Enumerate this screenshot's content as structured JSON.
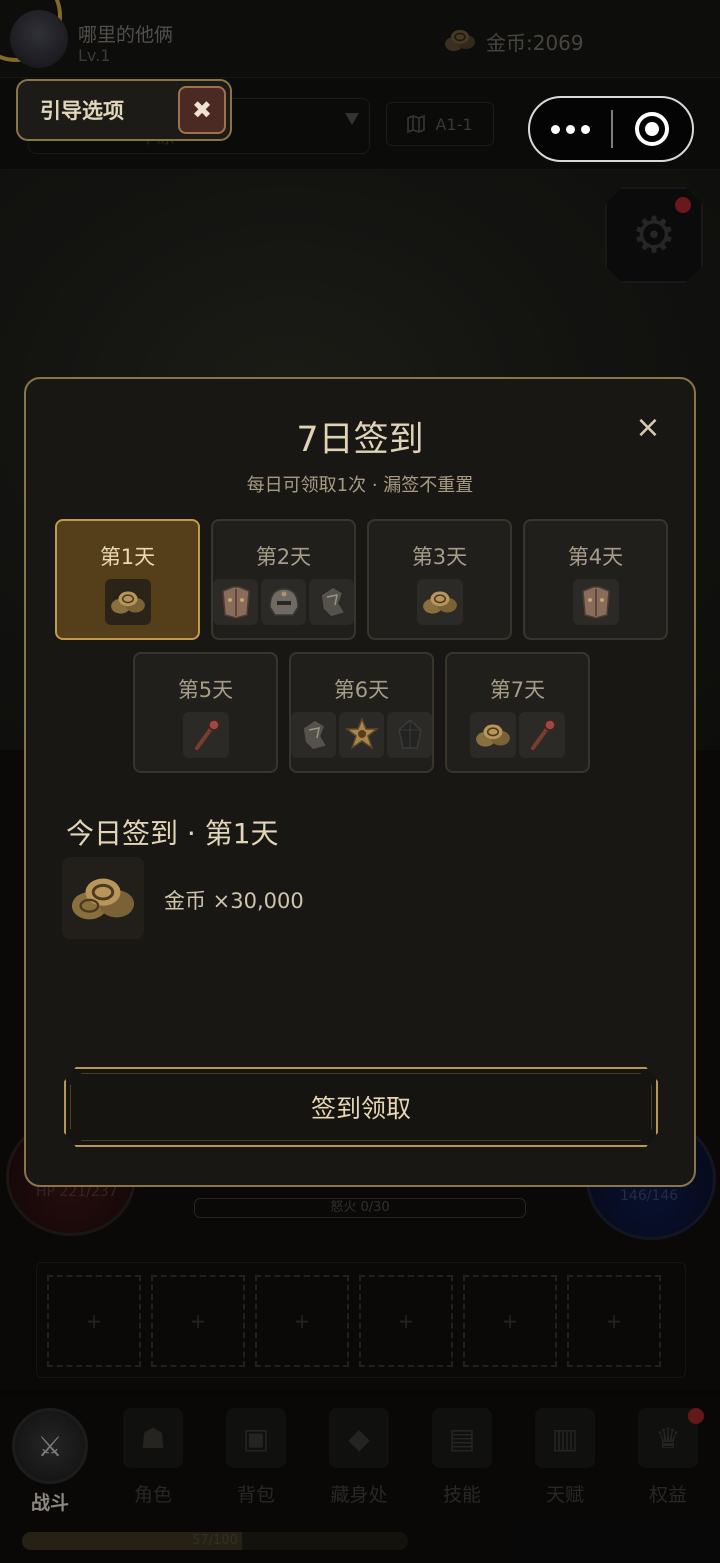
{
  "header": {
    "player_name": "哪里的他俩",
    "player_level": "Lv.1",
    "gold_label": "金币:2069"
  },
  "subbar": {
    "select_text": "平原",
    "map_label": "A1-1"
  },
  "guide": {
    "label": "引导选项",
    "close_glyph": "✖"
  },
  "rage": {
    "label": "怒火 0/30"
  },
  "hp": {
    "label": "HP 221/237"
  },
  "mp": {
    "label": "146/146"
  },
  "slots": [
    "+",
    "+",
    "+",
    "+",
    "+",
    "+"
  ],
  "nav": {
    "items": [
      {
        "label": "战斗",
        "icon": "crossed-swords-icon",
        "glyph": "⚔"
      },
      {
        "label": "角色",
        "icon": "character-helmet-icon",
        "glyph": "☗"
      },
      {
        "label": "背包",
        "icon": "backpack-icon",
        "glyph": "▣"
      },
      {
        "label": "藏身处",
        "icon": "hideout-icon",
        "glyph": "◆"
      },
      {
        "label": "技能",
        "icon": "skill-book-icon",
        "glyph": "▤"
      },
      {
        "label": "天赋",
        "icon": "talent-cards-icon",
        "glyph": "▥"
      },
      {
        "label": "权益",
        "icon": "crown-icon",
        "glyph": "♛"
      }
    ],
    "active_index": 0
  },
  "exp": {
    "label": "57/100",
    "progress": 0.57
  },
  "modal": {
    "title": "7日签到",
    "close_glyph": "×",
    "subtitle": "每日可领取1次 · 漏签不重置",
    "days": [
      {
        "label": "第1天",
        "items": [
          "gold-coins-icon"
        ],
        "selected": true
      },
      {
        "label": "第2天",
        "items": [
          "armor-chest-icon",
          "helmet-icon",
          "gauntlet-icon"
        ],
        "selected": false
      },
      {
        "label": "第3天",
        "items": [
          "gold-coins-icon"
        ],
        "selected": false
      },
      {
        "label": "第4天",
        "items": [
          "armor-chest-icon"
        ],
        "selected": false
      },
      {
        "label": "第5天",
        "items": [
          "wand-icon"
        ],
        "selected": false
      },
      {
        "label": "第6天",
        "items": [
          "gauntlet-icon",
          "amulet-icon",
          "dark-gem-icon"
        ],
        "selected": false
      },
      {
        "label": "第7天",
        "items": [
          "gold-coins-icon",
          "wand-icon"
        ],
        "selected": false
      }
    ],
    "today_title": "今日签到 · 第1天",
    "reward_text": "金币 ×30,000",
    "reward_icon": "gold-coins-icon",
    "claim_label": "签到领取"
  },
  "colors": {
    "accent_gold": "#c29a4c",
    "modal_bg": "#191714",
    "selected_card": "#553f1a",
    "notification_red": "#a4262a"
  }
}
